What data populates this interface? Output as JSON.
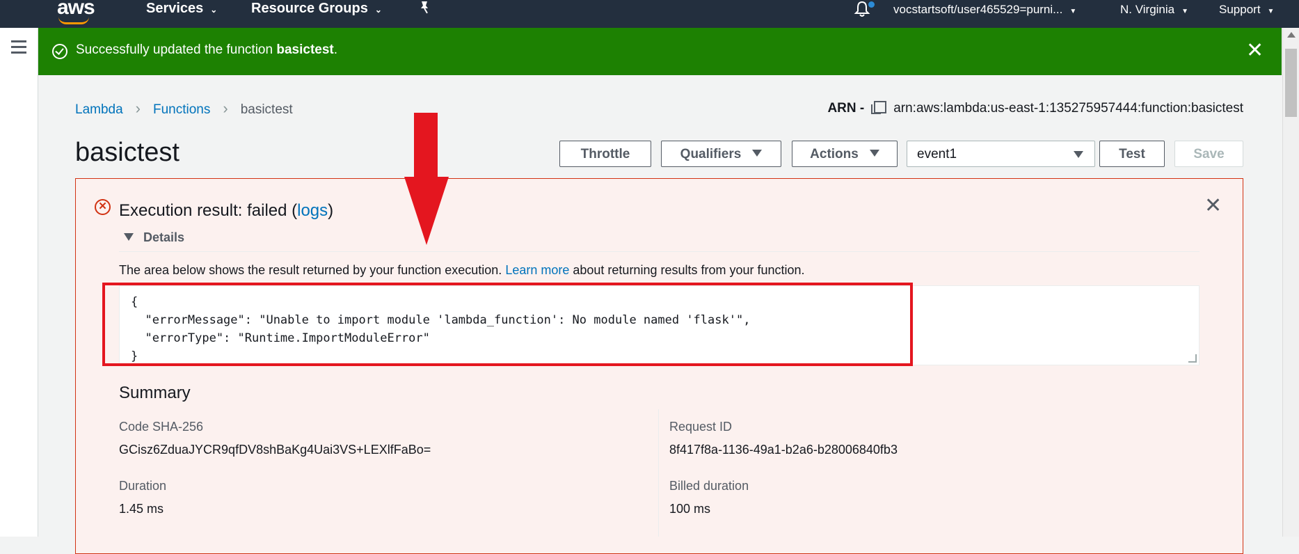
{
  "nav": {
    "logo": "aws",
    "services": "Services",
    "resource_groups": "Resource Groups",
    "account": "vocstartsoft/user465529=purni...",
    "region": "N. Virginia",
    "support": "Support"
  },
  "flash": {
    "prefix": "Successfully updated the function ",
    "function_name": "basictest",
    "suffix": "."
  },
  "breadcrumb": {
    "items": [
      "Lambda",
      "Functions",
      "basictest"
    ]
  },
  "arn": {
    "label": "ARN -",
    "value": "arn:aws:lambda:us-east-1:135275957444:function:basictest"
  },
  "page_title": "basictest",
  "toolbar": {
    "throttle": "Throttle",
    "qualifiers": "Qualifiers",
    "actions": "Actions",
    "test_event": "event1",
    "test": "Test",
    "save": "Save"
  },
  "result": {
    "title_prefix": "Execution result: failed (",
    "logs_link": "logs",
    "title_suffix": ")",
    "details_label": "Details",
    "desc_prefix": "The area below shows the result returned by your function execution. ",
    "desc_link": "Learn more",
    "desc_suffix": " about returning results from your function.",
    "output": "{\n  \"errorMessage\": \"Unable to import module 'lambda_function': No module named 'flask'\",\n  \"errorType\": \"Runtime.ImportModuleError\"\n}"
  },
  "summary": {
    "title": "Summary",
    "code_sha_label": "Code SHA-256",
    "code_sha_value": "GCisz6ZduaJYCR9qfDV8shBaKg4Uai3VS+LEXlfFaBo=",
    "request_id_label": "Request ID",
    "request_id_value": "8f417f8a-1136-49a1-b2a6-b28006840fb3",
    "duration_label": "Duration",
    "duration_value": "1.45 ms",
    "billed_label": "Billed duration",
    "billed_value": "100 ms"
  },
  "colors": {
    "nav_bg": "#232f3e",
    "success_green": "#1d8102",
    "error_red": "#d13212",
    "link_blue": "#0073bb",
    "annotation_red": "#e4161f"
  }
}
